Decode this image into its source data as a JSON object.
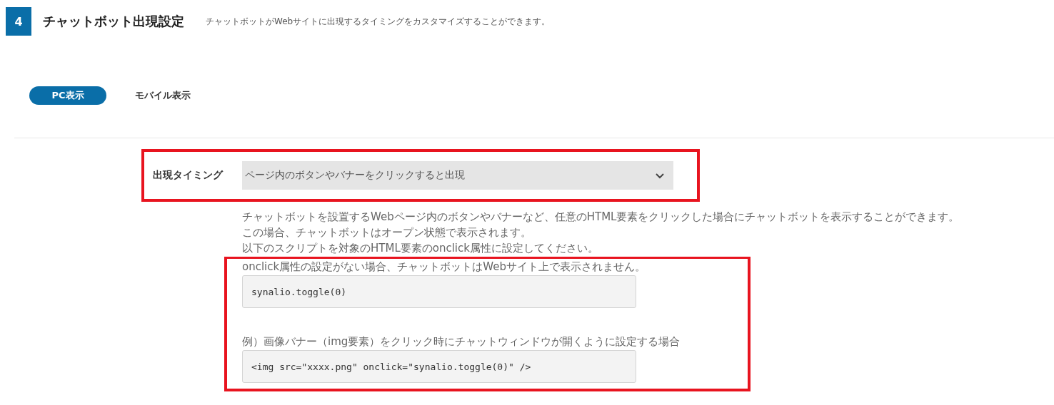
{
  "section": {
    "number": "4",
    "title": "チャットボット出現設定",
    "description": "チャットボットがWebサイトに出現するタイミングをカスタマイズすることができます。"
  },
  "tabs": [
    {
      "label": "PC表示",
      "selected": true
    },
    {
      "label": "モバイル表示",
      "selected": false
    }
  ],
  "setting": {
    "label": "出現タイミング",
    "select": {
      "value": "ページ内のボタンやバナーをクリックすると出現"
    }
  },
  "help": [
    "チャットボットを設置するWebページ内のボタンやバナーなど、任意のHTML要素をクリックした場合にチャットボットを表示することができます。",
    "この場合、チャットボットはオープン状態で表示されます。",
    "以下のスクリプトを対象のHTML要素のonclick属性に設定してください。"
  ],
  "blocks": [
    {
      "kind": "text",
      "text": "onclick属性の設定がない場合、チャットボットはWebサイト上で表示されません。"
    },
    {
      "kind": "code",
      "text": "synalio.toggle(0)"
    },
    {
      "kind": "text",
      "text": "例）画像バナー（img要素）をクリック時にチャットウィンドウが開くように設定する場合"
    },
    {
      "kind": "code",
      "text": "<img src=\"xxxx.png\" onclick=\"synalio.toggle(0)\" />"
    }
  ]
}
